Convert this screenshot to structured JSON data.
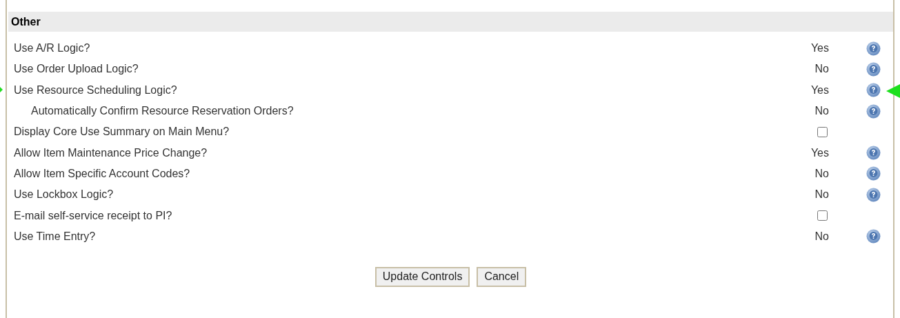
{
  "section": {
    "title": "Other"
  },
  "rows": [
    {
      "kind": "value",
      "label": "Use A/R Logic?",
      "value": "Yes",
      "help": true,
      "pointer": false
    },
    {
      "kind": "value",
      "label": "Use Order Upload Logic?",
      "value": "No",
      "help": true,
      "pointer": false
    },
    {
      "kind": "value",
      "label": "Use Resource Scheduling Logic?",
      "value": "Yes",
      "help": true,
      "pointer": true,
      "children": [
        {
          "kind": "value",
          "label": "Automatically Confirm Resource Reservation Orders?",
          "value": "No",
          "help": true,
          "pointer": false
        }
      ]
    },
    {
      "kind": "checkbox",
      "label": "Display Core Use Summary on Main Menu?",
      "checked": false,
      "help": false,
      "pointer": false
    },
    {
      "kind": "value",
      "label": "Allow Item Maintenance Price Change?",
      "value": "Yes",
      "help": true,
      "pointer": false
    },
    {
      "kind": "value",
      "label": "Allow Item Specific Account Codes?",
      "value": "No",
      "help": true,
      "pointer": false
    },
    {
      "kind": "value",
      "label": "Use Lockbox Logic?",
      "value": "No",
      "help": true,
      "pointer": false
    },
    {
      "kind": "checkbox",
      "label": "E-mail self-service receipt to PI?",
      "checked": false,
      "help": false,
      "pointer": false
    },
    {
      "kind": "value",
      "label": "Use Time Entry?",
      "value": "No",
      "help": true,
      "pointer": false
    }
  ],
  "buttons": [
    "Update Controls",
    "Cancel"
  ]
}
